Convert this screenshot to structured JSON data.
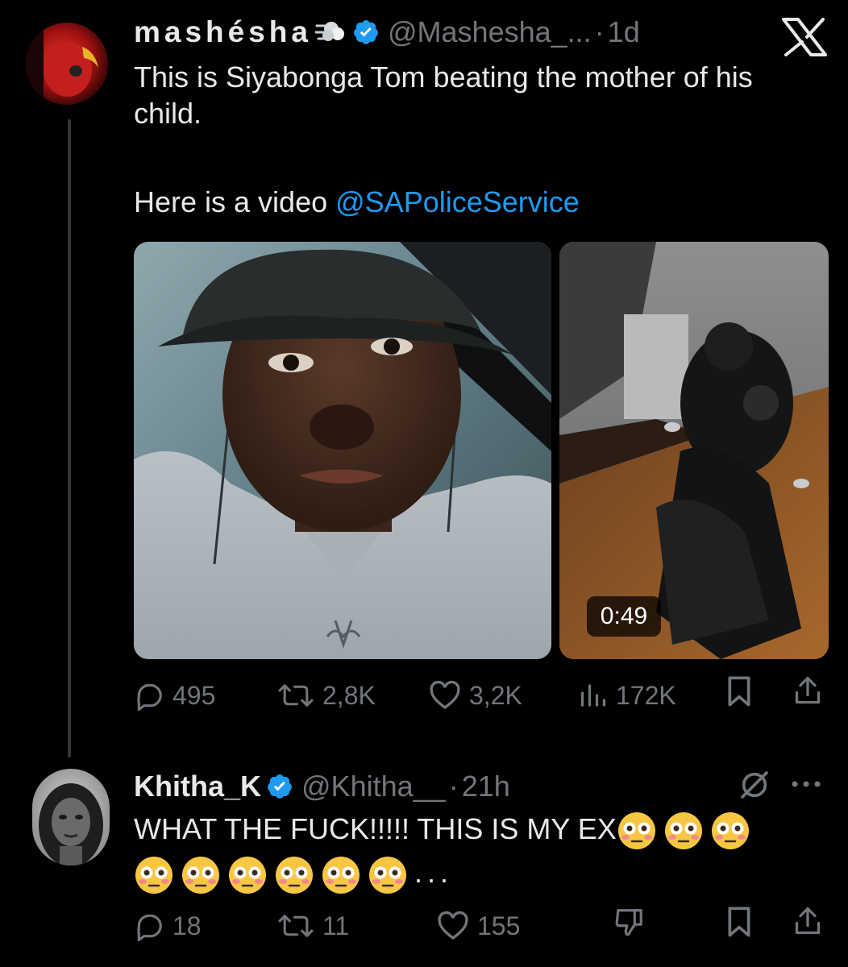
{
  "tweet1": {
    "display_name": "mashésha",
    "handle": "@Mashesha_...",
    "separator": "·",
    "time": "1d",
    "text_line1": "This is Siyabonga Tom beating the mother of his child.",
    "text_line2": "Here is a video ",
    "mention": "@SAPoliceService",
    "video_duration": "0:49",
    "replies": "495",
    "reposts": "2,8K",
    "likes": "3,2K",
    "views": "172K"
  },
  "tweet2": {
    "display_name": "Khitha_K",
    "handle": "@Khitha__",
    "separator": "·",
    "time": "21h",
    "text": "WHAT THE FUCK!!!!! THIS IS MY EX",
    "trailing": "...",
    "emoji_count": 9,
    "replies": "18",
    "reposts": "11",
    "likes": "155"
  },
  "icons": {
    "app": "x-logo-icon",
    "verified": "verified-badge-icon",
    "dash": "dash-emoji-icon",
    "reply": "reply-icon",
    "repost": "repost-icon",
    "like": "like-icon",
    "views": "views-icon",
    "bookmark": "bookmark-icon",
    "share": "share-icon",
    "grok": "grok-icon",
    "more": "more-icon",
    "dislike": "dislike-icon",
    "flushed": "flushed-face-emoji"
  },
  "colors": {
    "background": "#000000",
    "text": "#e7e9ea",
    "muted": "#71767b",
    "link": "#1d9bf0"
  }
}
